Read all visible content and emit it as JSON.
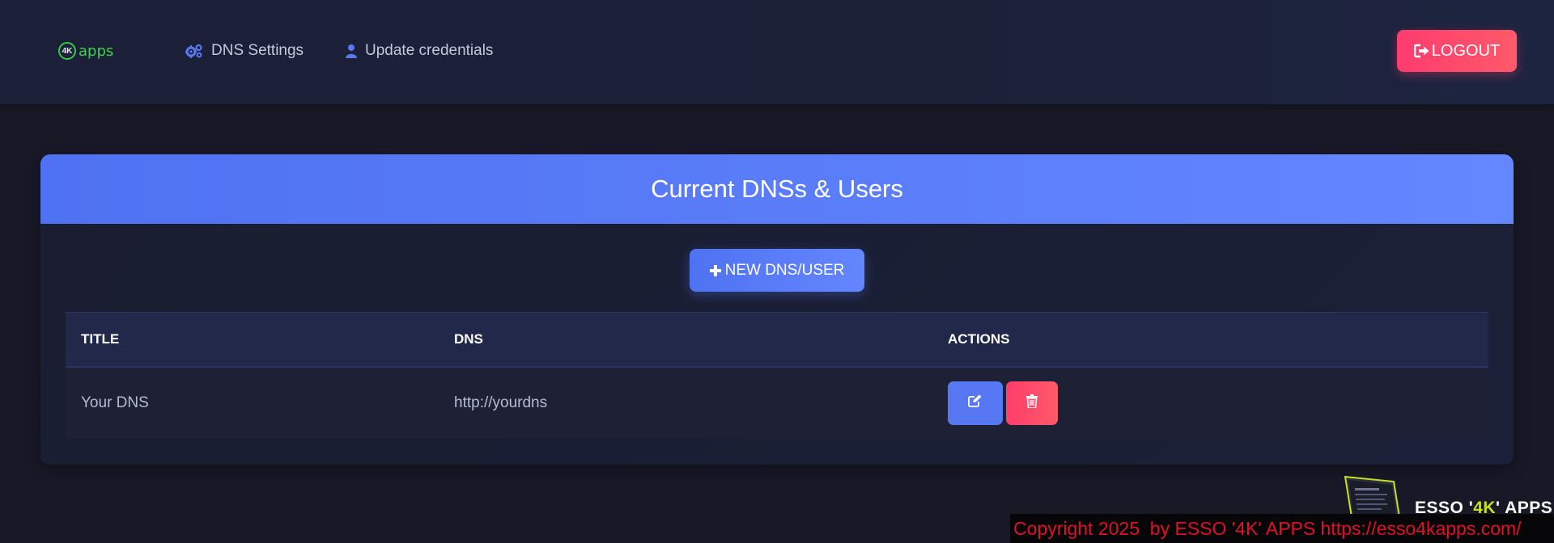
{
  "navbar": {
    "brand_mark": "4K",
    "brand_text": "apps",
    "nav_items": [
      {
        "label": "DNS Settings",
        "icon": "gears-icon"
      },
      {
        "label": "Update credentials",
        "icon": "user-icon"
      }
    ],
    "logout_label": "LOGOUT",
    "logout_icon": "sign-out-icon"
  },
  "card": {
    "title": "Current DNSs & Users",
    "new_button_label": "NEW DNS/USER",
    "new_button_icon": "plus-icon"
  },
  "table": {
    "columns": [
      "TITLE",
      "DNS",
      "ACTIONS"
    ],
    "rows": [
      {
        "title": "Your DNS",
        "dns": "http://yourdns"
      }
    ]
  },
  "footer": {
    "watermark_prefix": "ESSO '",
    "watermark_accent": "4K",
    "watermark_suffix": "' APPS",
    "copyright": "Copyright 2025  by ESSO '4K' APPS https://esso4kapps.com/"
  },
  "colors": {
    "accent_blue": "#5877f3",
    "danger_red": "#ff4468",
    "background": "#181827",
    "brand_green": "#3ecf4b",
    "copyright_red": "#e01026"
  }
}
